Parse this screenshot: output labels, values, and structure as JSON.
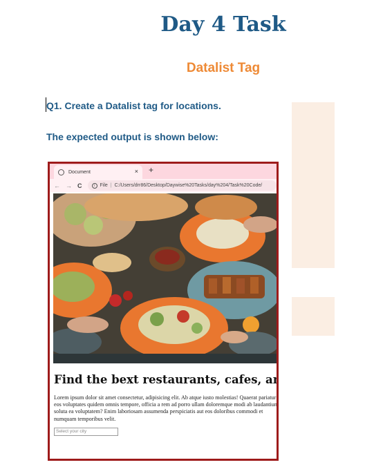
{
  "document": {
    "title": "Day 4 Task",
    "subtitle": "Datalist Tag",
    "question": "Q1. Create a Datalist tag for locations.",
    "expected_output_label": "The expected output is shown below:"
  },
  "screenshot": {
    "browser": {
      "tab_title": "Document",
      "tab_close": "×",
      "new_tab": "+",
      "nav_back": "←",
      "nav_forward": "→",
      "nav_reload": "C",
      "address_prefix": "File",
      "address_path": "C:/Users/drr86/Desktop/Daywise%20Tasks/day%204/Task%20Code/"
    },
    "page": {
      "heading": "Find the bext restaurants, cafes, and bars",
      "paragraph": "Lorem ipsum dolor sit amet consectetur, adipisicing elit. Ab atque iusto molestias! Quaerat pariatur eos voluptates quidem omnis tempore, officia a rem ad porro ullam doloremque modi ab laudantium soluta ea voluptatem? Enim laboriosam assumenda perspiciatis aut eos doloribus commodi et numquam temporibus velit.",
      "city_placeholder": "Select your city"
    }
  },
  "colors": {
    "title": "#1f5a86",
    "subtitle": "#ee8a36",
    "frame_border": "#9e1b1b",
    "tabbar": "#fdd7df"
  }
}
